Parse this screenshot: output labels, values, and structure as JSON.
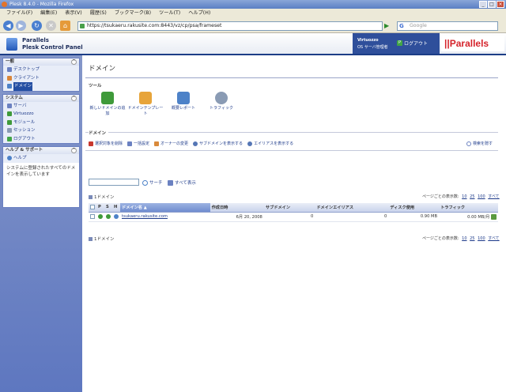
{
  "window": {
    "title": "Plesk 8.4.0 - Mozilla Firefox",
    "buttons": [
      "_",
      "□",
      "×"
    ]
  },
  "menu": [
    "ファイル(F)",
    "編集(E)",
    "表示(V)",
    "履歴(S)",
    "ブックマーク(B)",
    "ツール(T)",
    "ヘルプ(H)"
  ],
  "nav": {
    "url": "https://tsukaeru.rakusite.com:8443/vz/cp/psa/frameset",
    "search_placeholder": "Google"
  },
  "header": {
    "brand_title": "Parallels",
    "brand_subtitle": "Plesk Control Panel",
    "user_line1": "Virtuozzo",
    "user_line2": "OS サーバ管理者",
    "logout": "ログアウト",
    "logo": "||Parallels"
  },
  "sidebar": {
    "general": {
      "title": "一般",
      "items": [
        "デスクトップ",
        "クライアント",
        "ドメイン"
      ]
    },
    "system": {
      "title": "システム",
      "items": [
        "サーバ",
        "Virtuozzo",
        "モジュール",
        "セッション",
        "ログアウト"
      ]
    },
    "help": {
      "title": "ヘルプ & サポート",
      "items": [
        "ヘルプ"
      ],
      "text": "システムに登録されたすべてのドメインを表示しています"
    }
  },
  "main": {
    "title": "ドメイン",
    "tools_label": "ツール",
    "tools": [
      {
        "label": "新しいドメインの追加",
        "color": "#3f9a3a"
      },
      {
        "label": "ドメインテンプレート",
        "color": "#e7a43a"
      },
      {
        "label": "概要レポート",
        "color": "#4d82c8"
      },
      {
        "label": "トラフィック",
        "color": "#8a9bb4"
      }
    ],
    "domains_label": "ドメイン",
    "actions": [
      {
        "label": "選択対象を削除",
        "color": "#c8382e"
      },
      {
        "label": "一括設定",
        "color": "#6b81c1"
      },
      {
        "label": "オーナーの変更",
        "color": "#d98a3a"
      },
      {
        "label": "サブドメインを表示する",
        "color": "#5576b5"
      },
      {
        "label": "エイリアスを表示する",
        "color": "#5576b5"
      }
    ],
    "advanced_search": "検索を隠す",
    "search_button": "サーチ",
    "show_all_button": "すべて表示",
    "count_text": "1ドメイン",
    "pager_text": "ページごとの表示数:",
    "pager_options": [
      "10",
      "25",
      "100",
      "すべて"
    ],
    "columns": [
      "P",
      "S",
      "H",
      "ドメイン名",
      "作成日時",
      "サブドメイン",
      "ドメインエイリアス",
      "ディスク使用",
      "トラフィック"
    ],
    "rows": [
      {
        "domain": "tsukaeru.rakusite.com",
        "created": "6月 20, 2008",
        "subdomains": "0",
        "aliases": "0",
        "disk": "0.90 MB",
        "traffic": "0.00 MB/月"
      }
    ]
  }
}
